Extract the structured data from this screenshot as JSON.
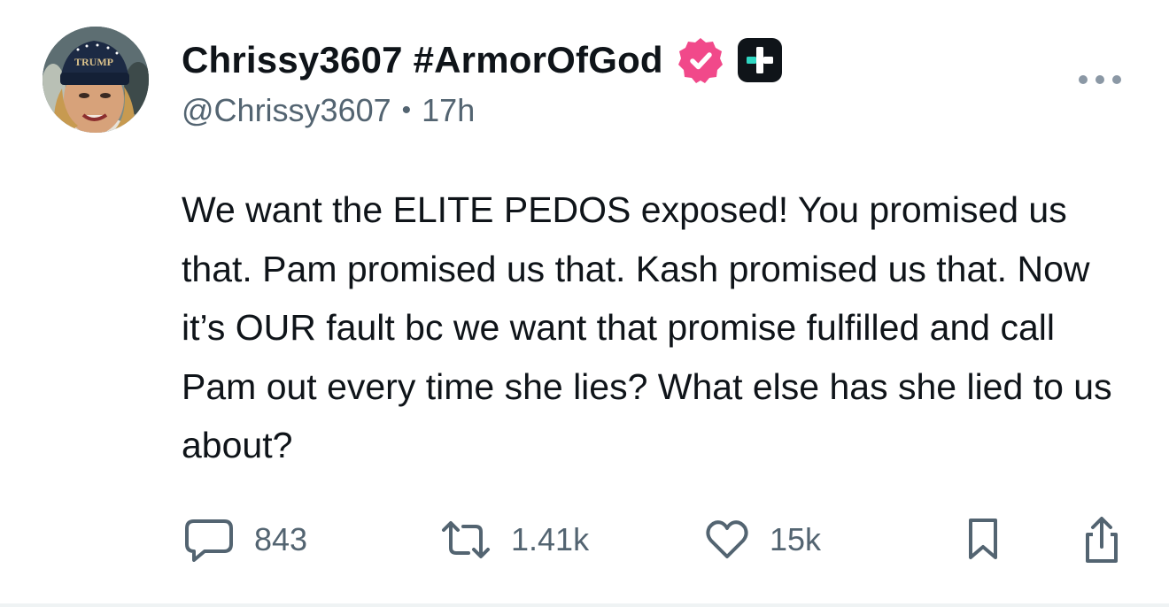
{
  "post": {
    "author": {
      "display_name": "Chrissy3607 #ArmorOfGod",
      "handle": "@Chrissy3607",
      "timestamp": "17h",
      "verified_badge_icon": "verified-badge-icon",
      "plus_badge_icon": "plus-badge-icon",
      "avatar_hat_text": "TRUMP"
    },
    "separator": "•",
    "text": "We want the ELITE PEDOS exposed! You promised us that. Pam promised us that. Kash promised us that. Now it’s OUR fault bc we want that promise fulfilled and call Pam out every time she lies? What else has she lied to us about?",
    "actions": {
      "reply_count": "843",
      "repost_count": "1.41k",
      "like_count": "15k"
    }
  },
  "colors": {
    "text_primary": "#0f1419",
    "text_secondary": "#536471",
    "verified_pink": "#f1498a",
    "plus_badge_bg": "#0f1419",
    "plus_badge_accent": "#2fd7c2"
  },
  "icons": [
    "more-options-icon",
    "reply-icon",
    "repost-icon",
    "like-icon",
    "bookmark-icon",
    "share-icon"
  ]
}
